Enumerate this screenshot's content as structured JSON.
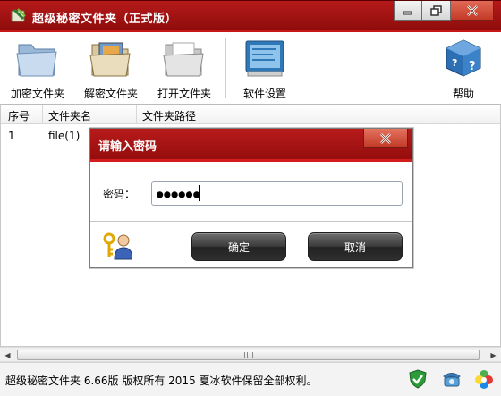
{
  "window": {
    "title": "超级秘密文件夹（正式版）"
  },
  "toolbar": {
    "items": [
      {
        "label": "加密文件夹",
        "icon": "folder-encrypt-icon"
      },
      {
        "label": "解密文件夹",
        "icon": "folder-decrypt-icon"
      },
      {
        "label": "打开文件夹",
        "icon": "folder-open-icon"
      },
      {
        "label": "软件设置",
        "icon": "settings-icon"
      },
      {
        "label": "帮助",
        "icon": "help-cube-icon"
      }
    ]
  },
  "table": {
    "columns": [
      "序号",
      "文件夹名",
      "文件夹路径"
    ],
    "rows": [
      {
        "index": "1",
        "name": "file(1)"
      }
    ]
  },
  "dialog": {
    "title": "请输入密码",
    "password_label": "密码：",
    "password_value": "●●●●●●",
    "confirm_label": "确定",
    "cancel_label": "取消"
  },
  "statusbar": {
    "text": "超级秘密文件夹 6.66版 版权所有 2015 夏冰软件保留全部权利。",
    "icons": [
      "shield-check-icon",
      "phone-icon",
      "color-flower-icon"
    ]
  },
  "colors": {
    "titlebar": "#a01414",
    "accent_line": "#d61d1d",
    "button_dark": "#2f2f2f"
  }
}
